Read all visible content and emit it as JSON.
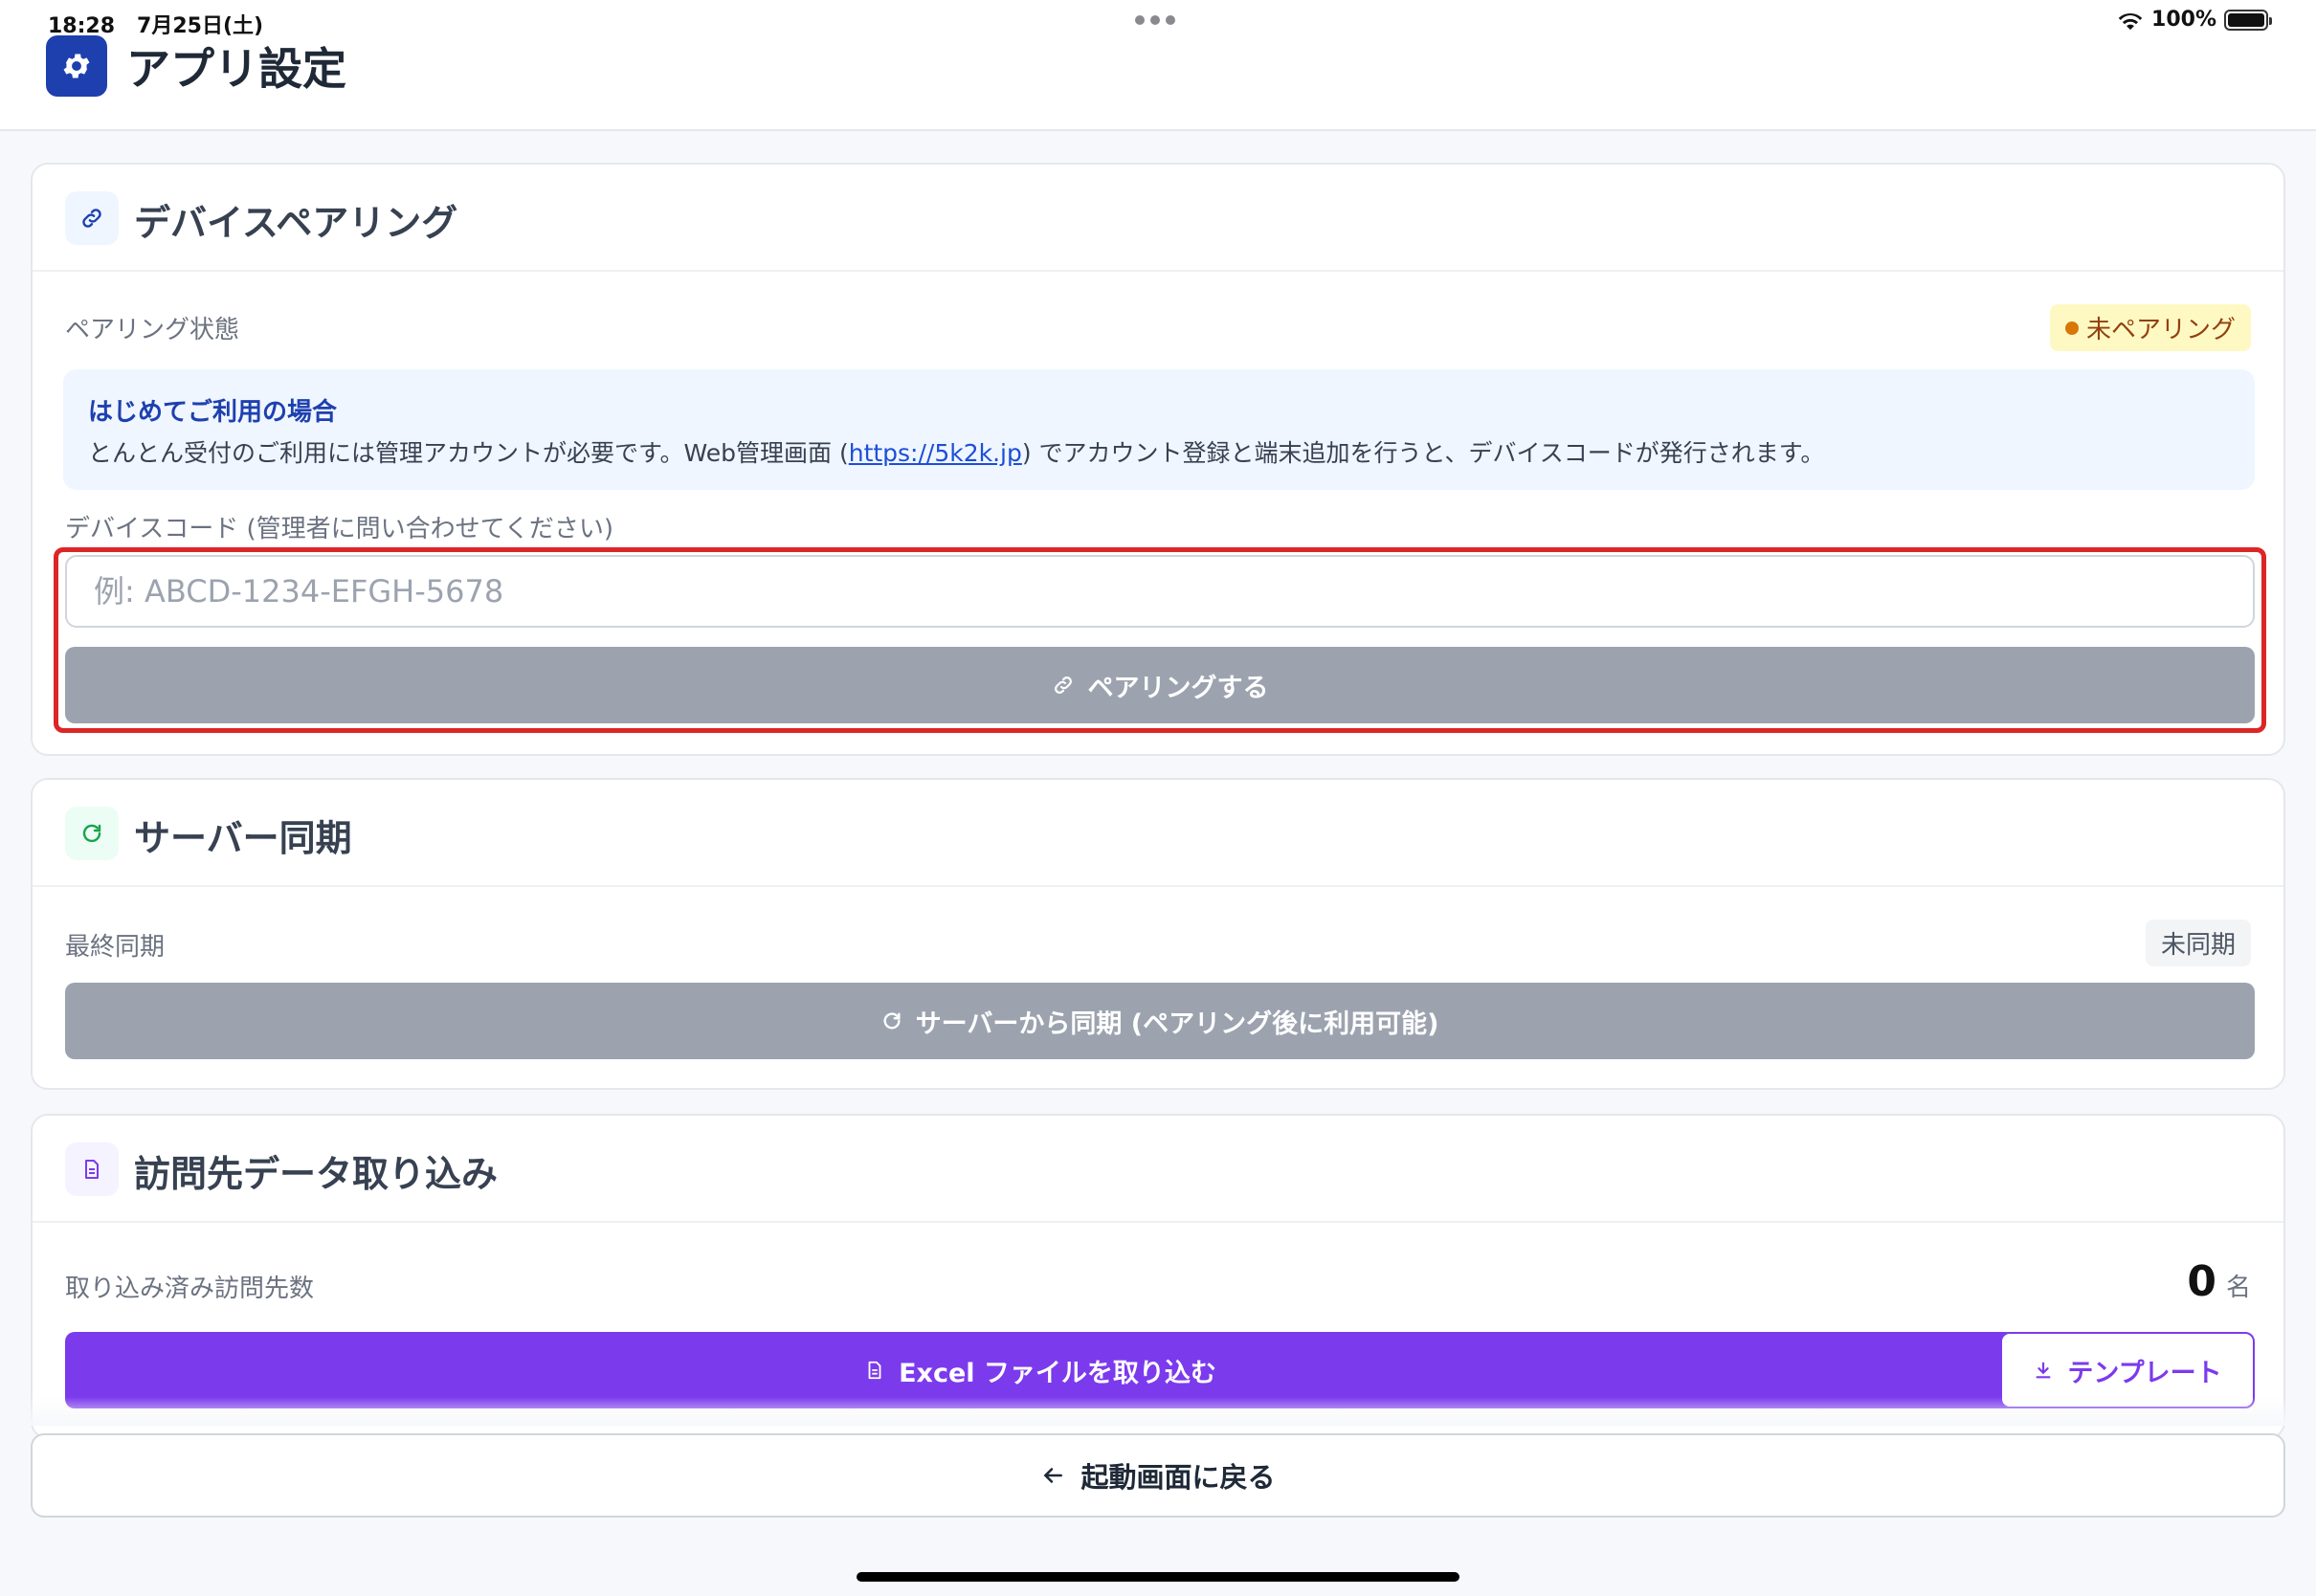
{
  "status_bar": {
    "time": "18:28",
    "date": "7月25日(土)",
    "battery": "100%"
  },
  "app": {
    "title": "アプリ設定",
    "icon": "gear-icon"
  },
  "pairing": {
    "title": "デバイスペアリング",
    "icon": "link-icon",
    "status_label": "ペアリング状態",
    "status_badge": "未ペアリング",
    "info_title": "はじめてご利用の場合",
    "info_text_before": "とんとん受付のご利用には管理アカウントが必要です。Web管理画面 (",
    "info_link": "https://5k2k.jp",
    "info_text_after": ") でアカウント登録と端末追加を行うと、デバイスコードが発行されます。",
    "code_label": "デバイスコード (管理者に問い合わせてください)",
    "code_placeholder": "例: ABCD-1234-EFGH-5678",
    "code_value": "",
    "pair_button": "ペアリングする"
  },
  "sync": {
    "title": "サーバー同期",
    "icon": "refresh-icon",
    "last_sync_label": "最終同期",
    "last_sync_value": "未同期",
    "sync_button": "サーバーから同期 (ペアリング後に利用可能)"
  },
  "import": {
    "title": "訪問先データ取り込み",
    "icon": "document-icon",
    "count_label": "取り込み済み訪問先数",
    "count_value": "0",
    "count_unit": "名",
    "excel_button": "Excel ファイルを取り込む",
    "template_button": "テンプレート"
  },
  "footer": {
    "back_button": "起動画面に戻る"
  },
  "colors": {
    "primary": "#1e40af",
    "purple": "#7c3aed",
    "disabled": "#9ca3af",
    "warning": "#d97706",
    "highlight": "#dc2626"
  }
}
